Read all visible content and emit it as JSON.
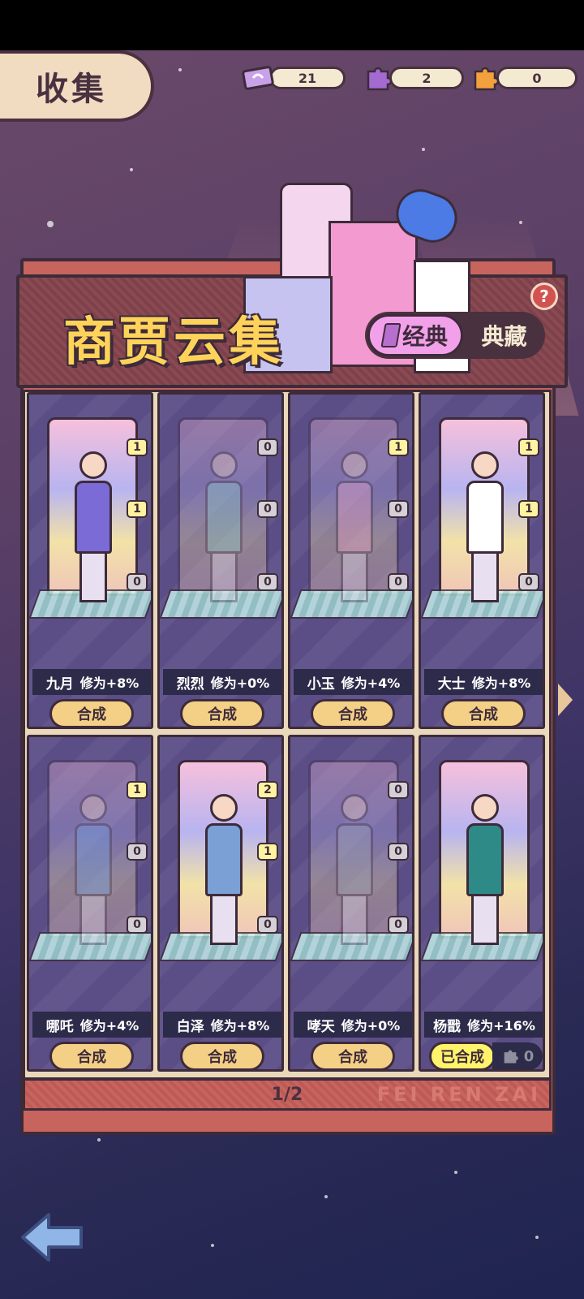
{
  "header": {
    "collect_label": "收集"
  },
  "currencies": [
    {
      "icon": "ticket-icon",
      "value": "21",
      "color": "#c9a1e8"
    },
    {
      "icon": "puzzle-purple-icon",
      "value": "2",
      "color": "#a36ad0"
    },
    {
      "icon": "puzzle-orange-icon",
      "value": "0",
      "color": "#f3a13c"
    }
  ],
  "banner": {
    "title": "商贾云集",
    "tab_classic": "经典",
    "tab_collection": "典藏",
    "help": "?"
  },
  "cards": [
    {
      "name": "九月",
      "bonus": "修为+8%",
      "badges": [
        "1",
        "1",
        "0"
      ],
      "button": "合成",
      "outfit": "#7a6bd6",
      "faded": false
    },
    {
      "name": "烈烈",
      "bonus": "修为+0%",
      "badges": [
        "0",
        "0",
        "0"
      ],
      "button": "合成",
      "outfit": "#8fd0c8",
      "faded": true
    },
    {
      "name": "小玉",
      "bonus": "修为+4%",
      "badges": [
        "1",
        "0",
        "0"
      ],
      "button": "合成",
      "outfit": "#f3a6c9",
      "faded": true
    },
    {
      "name": "大士",
      "bonus": "修为+8%",
      "badges": [
        "1",
        "1",
        "0"
      ],
      "button": "合成",
      "outfit": "#ffffff",
      "faded": false
    },
    {
      "name": "哪吒",
      "bonus": "修为+4%",
      "badges": [
        "1",
        "0",
        "0"
      ],
      "button": "合成",
      "outfit": "#6fa3e6",
      "faded": true
    },
    {
      "name": "白泽",
      "bonus": "修为+8%",
      "badges": [
        "2",
        "1",
        "0"
      ],
      "button": "合成",
      "outfit": "#7aa0d6",
      "faded": false
    },
    {
      "name": "哮天",
      "bonus": "修为+0%",
      "badges": [
        "0",
        "0",
        "0"
      ],
      "button": "合成",
      "outfit": "#9fa6b8",
      "faded": true
    },
    {
      "name": "杨戬",
      "bonus": "修为+16%",
      "badges": [],
      "button": "已合成",
      "outfit": "#2d8a86",
      "faded": false,
      "shards": "0"
    }
  ],
  "pager": {
    "page": "1/2",
    "brand": "FEI REN ZAI"
  },
  "neon_sign": "FEI REN ZAI"
}
